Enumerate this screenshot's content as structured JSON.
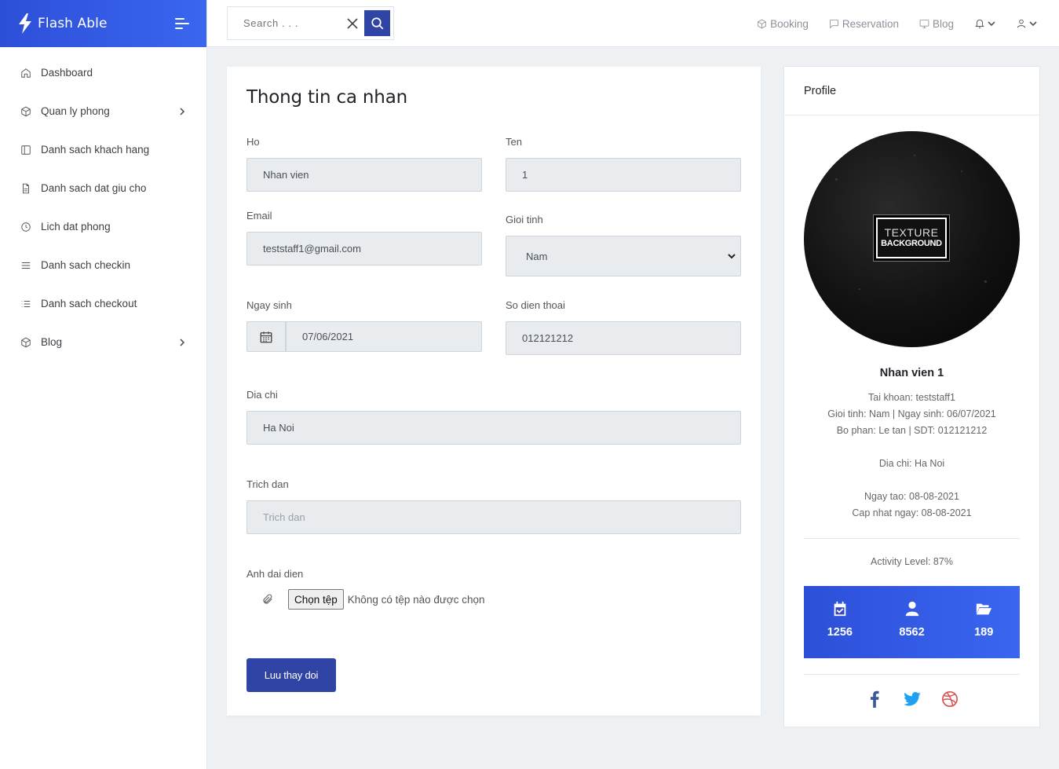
{
  "app": {
    "name": "Flash Able"
  },
  "sidebar": {
    "items": [
      {
        "label": "Dashboard",
        "icon": "home-icon",
        "has_children": false
      },
      {
        "label": "Quan ly phong",
        "icon": "box-icon",
        "has_children": true
      },
      {
        "label": "Danh sach khach hang",
        "icon": "sidebar-icon",
        "has_children": false
      },
      {
        "label": "Danh sach dat giu cho",
        "icon": "file-text-icon",
        "has_children": false
      },
      {
        "label": "Lich dat phong",
        "icon": "clock-icon",
        "has_children": false
      },
      {
        "label": "Danh sach checkin",
        "icon": "menu-icon",
        "has_children": false
      },
      {
        "label": "Danh sach checkout",
        "icon": "list-icon",
        "has_children": false
      },
      {
        "label": "Blog",
        "icon": "box-icon",
        "has_children": true
      }
    ]
  },
  "topbar": {
    "search_placeholder": "Search . . .",
    "links": [
      {
        "label": "Booking",
        "icon": "box-icon"
      },
      {
        "label": "Reservation",
        "icon": "message-square-icon"
      },
      {
        "label": "Blog",
        "icon": "monitor-icon"
      }
    ]
  },
  "form": {
    "title": "Thong tin ca nhan",
    "ho_label": "Ho",
    "ho_value": "Nhan vien",
    "ten_label": "Ten",
    "ten_value": "1",
    "email_label": "Email",
    "email_value": "teststaff1@gmail.com",
    "gender_label": "Gioi tinh",
    "gender_value": "Nam",
    "dob_label": "Ngay sinh",
    "dob_value": "07/06/2021",
    "phone_label": "So dien thoai",
    "phone_value": "012121212",
    "address_label": "Dia chi",
    "address_value": "Ha Noi",
    "quote_label": "Trich dan",
    "quote_placeholder": "Trich dan",
    "avatar_label": "Anh dai dien",
    "file_button": "Chọn tệp",
    "file_status": "Không có tệp nào được chọn",
    "save_button": "Luu thay doi"
  },
  "profile": {
    "header": "Profile",
    "avatar_text_1": "TEXTURE",
    "avatar_text_2": "BACKGROUND",
    "name": "Nhan vien 1",
    "account": "Tai khoan: teststaff1",
    "gender_dob": "Gioi tinh: Nam | Ngay sinh: 06/07/2021",
    "dept_phone": "Bo phan: Le tan | SDT: 012121212",
    "address": "Dia chi: Ha Noi",
    "created": "Ngay tao: 08-08-2021",
    "updated": "Cap nhat ngay: 08-08-2021",
    "activity": "Activity Level: 87%",
    "stats": [
      {
        "icon": "calendar-check-icon",
        "value": "1256"
      },
      {
        "icon": "user-icon",
        "value": "8562"
      },
      {
        "icon": "folder-open-icon",
        "value": "189"
      }
    ],
    "socials": [
      "facebook-icon",
      "twitter-icon",
      "dribbble-icon"
    ]
  },
  "colors": {
    "primary": "#2f44a4",
    "brand_gradient_start": "#2d4fd8",
    "brand_gradient_end": "#3a66f0",
    "facebook": "#3b5998",
    "twitter": "#1da1f2",
    "dribbble": "#ea4c89"
  }
}
